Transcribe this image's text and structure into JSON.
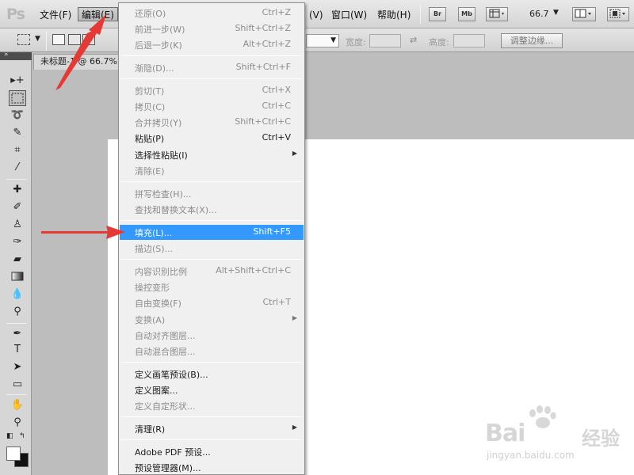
{
  "menubar": {
    "logo": "Ps",
    "file": "文件(F)",
    "edit": "编辑(E)",
    "image_tail": "(V)",
    "window": "窗口(W)",
    "help": "帮助(H)",
    "bridge": "Br",
    "mini_bridge": "Mb",
    "zoom": "66.7"
  },
  "optionsbar": {
    "width_label": "宽度:",
    "height_label": "高度:",
    "refine_edge": "调整边缘..."
  },
  "document": {
    "tab_title": "未标题-1 @ 66.7%"
  },
  "edit_menu": {
    "items": [
      {
        "label": "还原(O)",
        "shortcut": "Ctrl+Z",
        "disabled": true
      },
      {
        "label": "前进一步(W)",
        "shortcut": "Shift+Ctrl+Z",
        "disabled": true
      },
      {
        "label": "后退一步(K)",
        "shortcut": "Alt+Ctrl+Z",
        "disabled": true
      },
      {
        "label": "渐隐(D)...",
        "shortcut": "Shift+Ctrl+F",
        "disabled": true
      },
      {
        "label": "剪切(T)",
        "shortcut": "Ctrl+X",
        "disabled": true
      },
      {
        "label": "拷贝(C)",
        "shortcut": "Ctrl+C",
        "disabled": true
      },
      {
        "label": "合并拷贝(Y)",
        "shortcut": "Shift+Ctrl+C",
        "disabled": true
      },
      {
        "label": "粘贴(P)",
        "shortcut": "Ctrl+V",
        "disabled": false
      },
      {
        "label": "选择性粘贴(I)",
        "shortcut": "",
        "disabled": false,
        "submenu": true
      },
      {
        "label": "清除(E)",
        "shortcut": "",
        "disabled": true
      },
      {
        "label": "拼写检查(H)...",
        "shortcut": "",
        "disabled": true
      },
      {
        "label": "查找和替换文本(X)...",
        "shortcut": "",
        "disabled": true
      },
      {
        "label": "填充(L)...",
        "shortcut": "Shift+F5",
        "disabled": false,
        "highlighted": true
      },
      {
        "label": "描边(S)...",
        "shortcut": "",
        "disabled": true
      },
      {
        "label": "内容识别比例",
        "shortcut": "Alt+Shift+Ctrl+C",
        "disabled": true
      },
      {
        "label": "操控变形",
        "shortcut": "",
        "disabled": true
      },
      {
        "label": "自由变换(F)",
        "shortcut": "Ctrl+T",
        "disabled": true
      },
      {
        "label": "变换(A)",
        "shortcut": "",
        "disabled": true,
        "submenu": true
      },
      {
        "label": "自动对齐图层...",
        "shortcut": "",
        "disabled": true
      },
      {
        "label": "自动混合图层...",
        "shortcut": "",
        "disabled": true
      },
      {
        "label": "定义画笔预设(B)...",
        "shortcut": "",
        "disabled": false
      },
      {
        "label": "定义图案...",
        "shortcut": "",
        "disabled": false
      },
      {
        "label": "定义自定形状...",
        "shortcut": "",
        "disabled": true
      },
      {
        "label": "清理(R)",
        "shortcut": "",
        "disabled": false,
        "submenu": true
      },
      {
        "label": "Adobe PDF 预设...",
        "shortcut": "",
        "disabled": false
      },
      {
        "label": "预设管理器(M)...",
        "shortcut": "",
        "disabled": false
      }
    ]
  },
  "watermark": {
    "brand": "Bai",
    "brand_suffix": "经验",
    "url": "jingyan.baidu.com"
  },
  "colors": {
    "highlight": "#3399ff",
    "annotation_arrow": "#e53935"
  }
}
